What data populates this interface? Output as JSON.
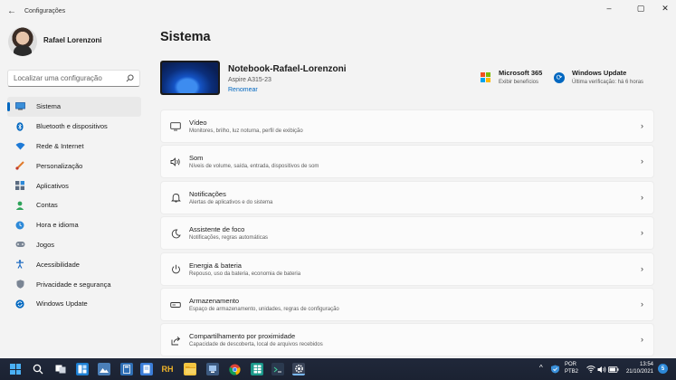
{
  "window": {
    "title": "Configurações",
    "back_glyph": "←",
    "minimize_glyph": "–",
    "maximize_glyph": "▢",
    "close_glyph": "✕"
  },
  "profile": {
    "name": "Rafael Lorenzoni"
  },
  "search": {
    "placeholder": "Localizar uma configuração",
    "icon": "search-icon"
  },
  "nav": {
    "items": [
      {
        "label": "Sistema",
        "icon": "monitor-icon",
        "active": true
      },
      {
        "label": "Bluetooth e dispositivos",
        "icon": "bluetooth-icon"
      },
      {
        "label": "Rede & Internet",
        "icon": "wifi-icon"
      },
      {
        "label": "Personalização",
        "icon": "brush-icon"
      },
      {
        "label": "Aplicativos",
        "icon": "apps-icon"
      },
      {
        "label": "Contas",
        "icon": "person-icon"
      },
      {
        "label": "Hora e idioma",
        "icon": "globe-clock-icon"
      },
      {
        "label": "Jogos",
        "icon": "gamepad-icon"
      },
      {
        "label": "Acessibilidade",
        "icon": "accessibility-icon"
      },
      {
        "label": "Privacidade e segurança",
        "icon": "shield-icon"
      },
      {
        "label": "Windows Update",
        "icon": "update-icon"
      }
    ]
  },
  "main": {
    "title": "Sistema",
    "device": {
      "name": "Notebook-Rafael-Lorenzoni",
      "model": "Aspire A315-23",
      "rename_label": "Renomear"
    },
    "microsoft365": {
      "title": "Microsoft 365",
      "subtitle": "Exibir benefícios"
    },
    "windows_update": {
      "title": "Windows Update",
      "subtitle": "Última verificação: há 6 horas"
    },
    "cards": [
      {
        "title": "Vídeo",
        "subtitle": "Monitores, brilho, luz noturna, perfil de exibição",
        "icon": "display-icon"
      },
      {
        "title": "Som",
        "subtitle": "Níveis de volume, saída, entrada, dispositivos de som",
        "icon": "speaker-icon"
      },
      {
        "title": "Notificações",
        "subtitle": "Alertas de aplicativos e do sistema",
        "icon": "bell-icon"
      },
      {
        "title": "Assistente de foco",
        "subtitle": "Notificações, regras automáticas",
        "icon": "moon-icon"
      },
      {
        "title": "Energia & bateria",
        "subtitle": "Repouso, uso da bateria, economia de bateria",
        "icon": "power-icon"
      },
      {
        "title": "Armazenamento",
        "subtitle": "Espaço de armazenamento, unidades, regras de configuração",
        "icon": "storage-icon"
      },
      {
        "title": "Compartilhamento por proximidade",
        "subtitle": "Capacidade de descoberta, local de arquivos recebidos",
        "icon": "share-icon"
      }
    ],
    "chevron_glyph": "›"
  },
  "taskbar": {
    "rh_label": "RH",
    "tray": {
      "chevron": "^",
      "language_line1": "POR",
      "language_line2": "PTB2",
      "time": "13:54",
      "date": "21/10/2021",
      "notification_count": "5"
    }
  },
  "colors": {
    "accent": "#0067c0",
    "background": "#f3f3f3",
    "card": "#fbfbfb",
    "taskbar": "#1f2737"
  }
}
